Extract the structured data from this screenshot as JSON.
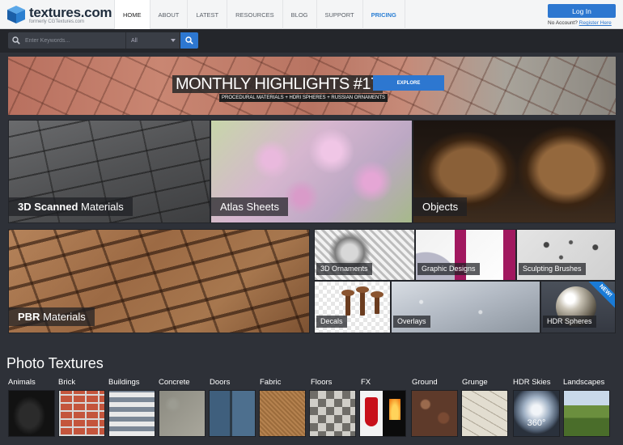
{
  "header": {
    "logo_word": "textures.com",
    "logo_sub": "formerly CGTextures.com",
    "nav": [
      {
        "label": "HOME"
      },
      {
        "label": "ABOUT"
      },
      {
        "label": "LATEST"
      },
      {
        "label": "RESOURCES"
      },
      {
        "label": "BLOG"
      },
      {
        "label": "SUPPORT"
      },
      {
        "label": "PRICING"
      }
    ],
    "login_label": "Log In",
    "no_account_text": "No Account?",
    "register_label": "Register Here"
  },
  "search": {
    "placeholder": "Enter Keywords...",
    "category_value": "All"
  },
  "banner": {
    "title": "MONTHLY HIGHLIGHTS #17",
    "explore_label": "EXPLORE",
    "subtitle": "PROCEDURAL MATERIALS + HDRI SPHERES + RUSSIAN ORNAMENTS"
  },
  "tiles": {
    "scanned": {
      "bold": "3D Scanned",
      "rest": " Materials"
    },
    "atlas": {
      "label": "Atlas Sheets"
    },
    "objects": {
      "label": "Objects"
    },
    "pbr": {
      "bold": "PBR",
      "rest": " Materials"
    },
    "ornaments": {
      "label": "3D Ornaments"
    },
    "graphic": {
      "label": "Graphic Designs"
    },
    "sculpt": {
      "label": "Sculpting Brushes"
    },
    "decals": {
      "label": "Decals"
    },
    "overlays": {
      "label": "Overlays"
    },
    "hdr_spheres": {
      "label": "HDR Spheres",
      "badge": "NEW!"
    }
  },
  "photo_textures": {
    "title": "Photo Textures",
    "categories": [
      {
        "label": "Animals"
      },
      {
        "label": "Brick"
      },
      {
        "label": "Buildings"
      },
      {
        "label": "Concrete"
      },
      {
        "label": "Doors"
      },
      {
        "label": "Fabric"
      },
      {
        "label": "Floors"
      },
      {
        "label": "FX"
      },
      {
        "label": "Ground"
      },
      {
        "label": "Grunge"
      },
      {
        "label": "HDR Skies"
      },
      {
        "label": "Landscapes"
      }
    ],
    "hdr_skies_overlay": "360°"
  },
  "colors": {
    "accent": "#2d77d0",
    "page_bg": "#2e3138",
    "graphic_magenta": "#a1185f"
  }
}
